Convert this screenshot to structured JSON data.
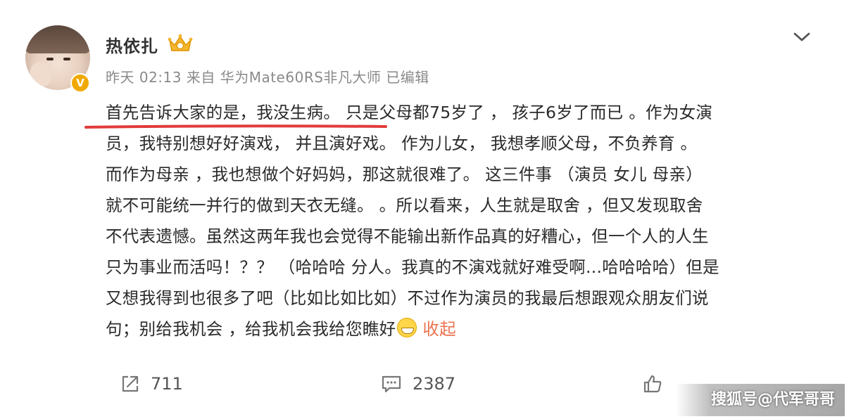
{
  "post": {
    "author_name": "热依扎",
    "meta": "昨天 02:13  来自 华为Mate60RS非凡大师 已编辑",
    "verified_badge": "V",
    "content_lines": [
      "首先告诉大家的是，我没生病。 只是父母都75岁了 ， 孩子6岁了而已 。作为女演",
      "员，我特别想好好演戏，  并且演好戏。 作为儿女，  我想孝顺父母，不负养育 。",
      "而作为母亲 ，我也想做个好妈妈，那这就很难了。  这三件事 （演员 女儿 母亲）",
      "就不可能统一并行的做到天衣无缝。 。所以看来，人生就是取舍 ，但又发现取舍",
      "不代表遗憾。虽然这两年我也会觉得不能输出新作品真的好糟心，但一个人的人生",
      "只为事业而活吗！？？   （哈哈哈 分人。我真的不演戏就好难受啊...哈哈哈哈）但是",
      "又想我得到也很多了吧（比如比如比如）不过作为演员的我最后想跟观众朋友们说",
      "句；别给我机会 ，给我机会我给您瞧好"
    ],
    "collapse_label": "收起",
    "icons": {
      "chevron": "chevron-down-icon",
      "vip": "crown-vip-icon",
      "emoji": "grin-emoji-icon",
      "repost": "repost-icon",
      "comment": "comment-icon",
      "like": "thumbs-up-icon"
    },
    "highlight_color": "#e23b3b",
    "link_color": "#eb7350"
  },
  "actions": {
    "repost_count": "711",
    "comment_count": "2387",
    "like_count": ""
  },
  "watermark": "搜狐号@代军哥哥"
}
